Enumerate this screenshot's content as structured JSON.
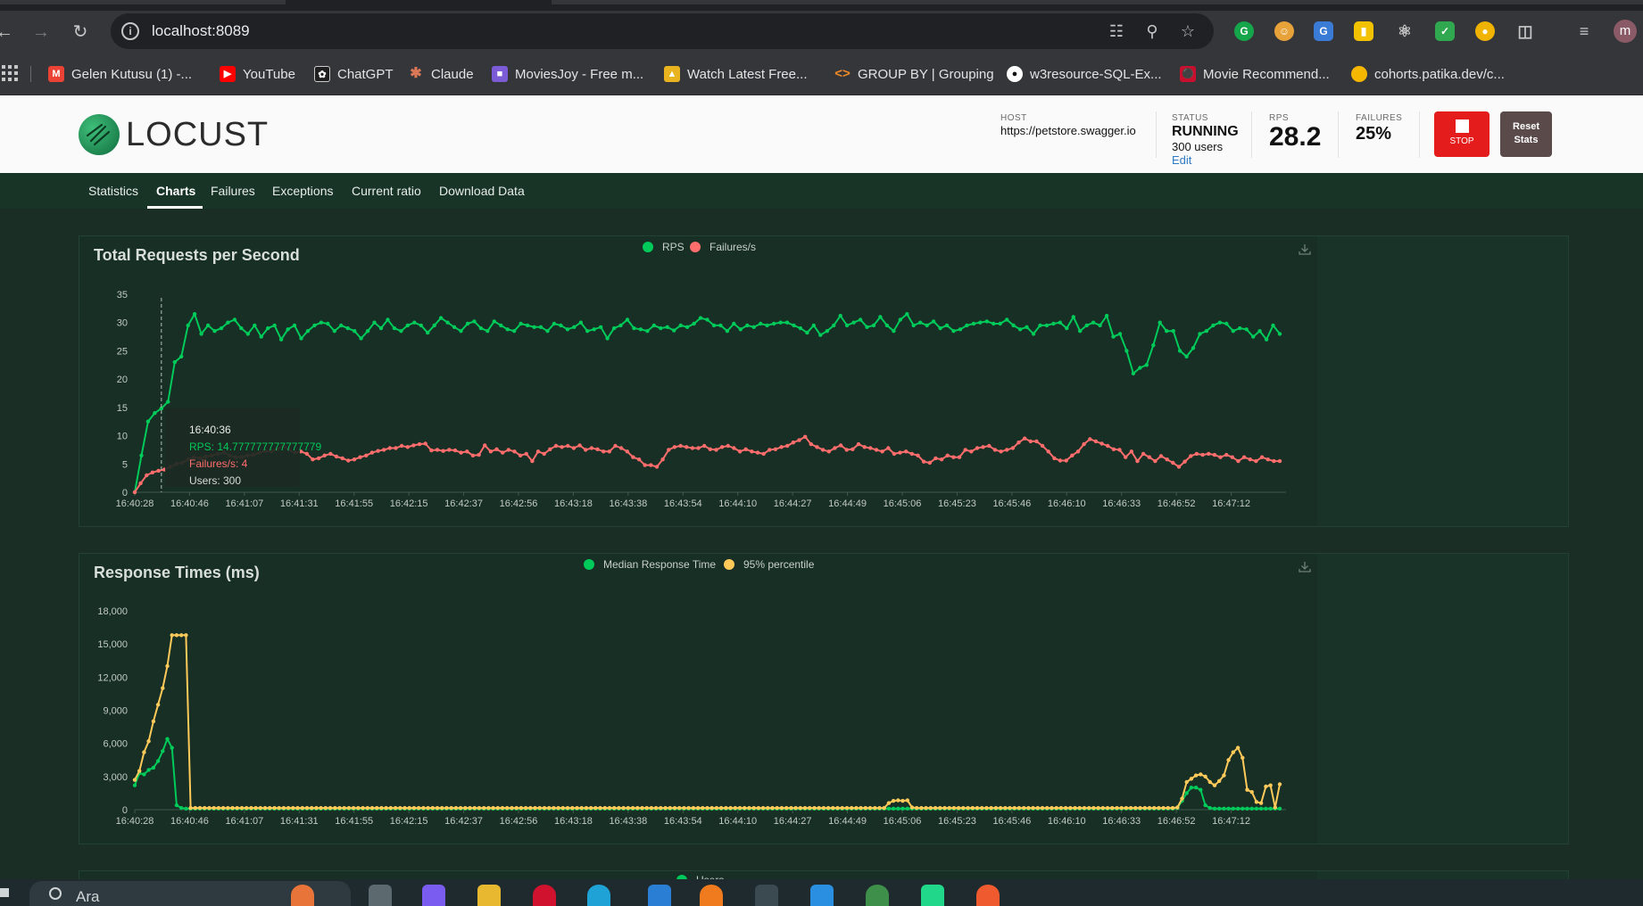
{
  "browser": {
    "url": "localhost:8089",
    "bookmarks": [
      {
        "label": "Gelen Kutusu (1) -...",
        "color": "#ea4335"
      },
      {
        "label": "YouTube",
        "color": "#ff0000"
      },
      {
        "label": "ChatGPT",
        "color": "#1f1f1f"
      },
      {
        "label": "Claude",
        "color": "#d97757"
      },
      {
        "label": "MoviesJoy - Free m...",
        "color": "#7b5cd6"
      },
      {
        "label": "Watch Latest Free...",
        "color": "#e8b31e"
      },
      {
        "label": "GROUP BY | Grouping",
        "color": "#f08a24"
      },
      {
        "label": "w3resource-SQL-Ex...",
        "color": "#ffffff"
      },
      {
        "label": "Movie Recommend...",
        "color": "#c8102e"
      },
      {
        "label": "cohorts.patika.dev/c...",
        "color": "#f6b700"
      }
    ],
    "profile_initial": "m"
  },
  "locust": {
    "logo_text": "LOCUST",
    "host_label": "HOST",
    "host": "https://petstore.swagger.io",
    "status_label": "STATUS",
    "status": "RUNNING",
    "users": "300 users",
    "edit": "Edit",
    "rps_label": "RPS",
    "rps": "28.2",
    "failures_label": "FAILURES",
    "failures": "25%",
    "stop_label": "STOP",
    "reset_label_1": "Reset",
    "reset_label_2": "Stats",
    "tabs": [
      "Statistics",
      "Charts",
      "Failures",
      "Exceptions",
      "Current ratio",
      "Download Data"
    ],
    "active_tab": "Charts"
  },
  "colors": {
    "green": "#00ca5a",
    "red": "#ff6d6d",
    "yellow": "#ffca5a"
  },
  "chart_data": [
    {
      "type": "line",
      "title": "Total Requests per Second",
      "x_ticks": [
        "16:40:28",
        "16:40:46",
        "16:41:07",
        "16:41:31",
        "16:41:55",
        "16:42:15",
        "16:42:37",
        "16:42:56",
        "16:43:18",
        "16:43:38",
        "16:43:54",
        "16:44:10",
        "16:44:27",
        "16:44:49",
        "16:45:06",
        "16:45:23",
        "16:45:46",
        "16:46:10",
        "16:46:33",
        "16:46:52",
        "16:47:12"
      ],
      "ylim": [
        0,
        35
      ],
      "y_ticks": [
        0,
        5,
        10,
        15,
        20,
        25,
        30,
        35
      ],
      "series": [
        {
          "name": "RPS",
          "color": "#00ca5a",
          "values": [
            0,
            6.5,
            12.5,
            14,
            14.8,
            16,
            23,
            24,
            29.5,
            31.5,
            28,
            29.5,
            28.5,
            29,
            30,
            30.5,
            29,
            28,
            29.5,
            27.5,
            29,
            29.5,
            27,
            28.8,
            29.5,
            27.2,
            28.5,
            29.5,
            30,
            29.8,
            28.5,
            29.5,
            29,
            28.5,
            27.2,
            28.5,
            30,
            29,
            30.5,
            29,
            28.5,
            29.5,
            30,
            29.5,
            28.2,
            29.5,
            30.8,
            30,
            29.2,
            28.5,
            29.8,
            30.2,
            29,
            28.5,
            30.2,
            29.5,
            28.8,
            28.5,
            29.8,
            29.5,
            29.2,
            29.2,
            28.5,
            29.8,
            29.5,
            28.8,
            29.2,
            30,
            28.5,
            28.8,
            29.2,
            27.2,
            29,
            29.5,
            30.5,
            29,
            28.8,
            28.5,
            29.5,
            29,
            29.2,
            28.6,
            29.5,
            29.2,
            29.8,
            30.8,
            30.5,
            29.5,
            29.5,
            28.5,
            29.8,
            28.8,
            29.5,
            29.2,
            29.8,
            29.5,
            29.8,
            30,
            30,
            29.5,
            29,
            28.2,
            29.5,
            27.8,
            28.5,
            29.5,
            31.2,
            29.5,
            30,
            30.5,
            29.2,
            29.5,
            31,
            29.5,
            28.5,
            30.5,
            31.5,
            29.5,
            30,
            29.5,
            30.2,
            29,
            29.5,
            28.5,
            28.8,
            29.5,
            29.8,
            30,
            30.2,
            29.8,
            29.8,
            30.5,
            29.5,
            28.8,
            29.2,
            28,
            29.5,
            29.5,
            29.8,
            30,
            29,
            31,
            28.5,
            29.5,
            30,
            29.5,
            31.2,
            27.5,
            28,
            25,
            21,
            22,
            22.5,
            26,
            30,
            28.5,
            28.5,
            25,
            24,
            25.5,
            28,
            28.5,
            29.5,
            30,
            29.8,
            28.5,
            29,
            28.8,
            27.5,
            28.5,
            27,
            29.5,
            28
          ]
        },
        {
          "name": "Failures/s",
          "color": "#ff6d6d",
          "values": [
            0,
            1.6,
            3,
            3.5,
            3.8,
            4,
            4.5,
            5,
            5.2,
            5.8,
            6.2,
            6,
            6.3,
            6.5,
            6.8,
            7,
            6.5,
            6.2,
            6.2,
            6.5,
            6.6,
            7,
            7.3,
            7.2,
            7.6,
            8.2,
            7.5,
            7,
            7.2,
            6.8,
            5.8,
            6,
            6.5,
            6.8,
            6.3,
            6,
            5.6,
            5.8,
            6.2,
            6.5,
            7,
            7.3,
            7.5,
            7.8,
            7.8,
            8.2,
            8,
            8.3,
            8.5,
            8.6,
            7.4,
            7.5,
            7.3,
            7.5,
            7.4,
            7,
            7.2,
            6.5,
            6.6,
            8.3,
            7.2,
            7.6,
            7,
            7.5,
            7.2,
            6.5,
            6.8,
            5.5,
            7.2,
            6.8,
            7.6,
            8.2,
            8,
            8.2,
            7.8,
            8.3,
            7.5,
            7.8,
            7.6,
            7.2,
            7.2,
            8.2,
            7.8,
            7.2,
            6.2,
            5.8,
            4.8,
            4.8,
            4.5,
            5.8,
            7.5,
            8,
            8.2,
            8,
            7.8,
            7.8,
            8.2,
            7.6,
            7.5,
            8,
            8.2,
            7.8,
            7.2,
            7.6,
            7.2,
            7,
            6.8,
            7.5,
            7.6,
            8,
            8.2,
            8.8,
            9.2,
            9.8,
            8.5,
            8,
            7.5,
            7.2,
            7.8,
            8.3,
            7.5,
            7.6,
            8.5,
            8,
            7.8,
            7.5,
            7.2,
            7.8,
            6.8,
            7,
            7.2,
            6.8,
            6.5,
            5.4,
            5.2,
            6,
            5.8,
            6.5,
            6.2,
            6.2,
            7.5,
            7.2,
            7.8,
            8,
            8.2,
            7.5,
            7.2,
            7.5,
            7.8,
            8.8,
            9.5,
            9,
            9,
            8.2,
            7.2,
            6,
            5.6,
            5.6,
            6.5,
            7.2,
            8.5,
            9.4,
            9,
            8.6,
            8.2,
            7.6,
            7.5,
            6.2,
            7.2,
            5.5,
            6.8,
            6.2,
            5.5,
            6.4,
            5.8,
            5.2,
            4.5,
            5.4,
            6.4,
            6.8,
            6.6,
            6.8,
            6.6,
            6.2,
            6.6,
            6.2,
            5.5,
            6.2,
            5.8,
            5.5,
            6.2,
            5.8,
            5.5,
            5.5
          ]
        }
      ],
      "tooltip": {
        "time": "16:40:36",
        "rps": "RPS: 14.777777777777779",
        "failures": "Failures/s: 4",
        "users": "Users: 300",
        "index": 4
      }
    },
    {
      "type": "line",
      "title": "Response Times (ms)",
      "x_ticks": [
        "16:40:28",
        "16:40:46",
        "16:41:07",
        "16:41:31",
        "16:41:55",
        "16:42:15",
        "16:42:37",
        "16:42:56",
        "16:43:18",
        "16:43:38",
        "16:43:54",
        "16:44:10",
        "16:44:27",
        "16:44:49",
        "16:45:06",
        "16:45:23",
        "16:45:46",
        "16:46:10",
        "16:46:33",
        "16:46:52",
        "16:47:12"
      ],
      "ylim": [
        0,
        18000
      ],
      "y_ticks": [
        0,
        3000,
        6000,
        9000,
        12000,
        15000,
        18000
      ],
      "series": [
        {
          "name": "Median Response Time",
          "color": "#00ca5a",
          "values": [
            2200,
            3300,
            3200,
            3600,
            3800,
            4400,
            5300,
            6400,
            5600,
            400,
            150,
            100,
            100,
            100,
            100,
            100,
            100,
            100,
            100,
            100,
            100,
            100,
            100,
            100,
            100,
            100,
            100,
            100,
            100,
            100,
            100,
            100,
            100,
            100,
            100,
            100,
            100,
            100,
            100,
            100,
            100,
            100,
            100,
            100,
            100,
            100,
            100,
            100,
            100,
            100,
            100,
            100,
            100,
            100,
            100,
            100,
            100,
            100,
            100,
            100,
            100,
            100,
            100,
            100,
            100,
            100,
            100,
            100,
            100,
            100,
            100,
            100,
            100,
            100,
            100,
            100,
            100,
            100,
            100,
            100,
            100,
            100,
            100,
            100,
            100,
            100,
            100,
            100,
            100,
            100,
            100,
            100,
            100,
            100,
            100,
            100,
            100,
            100,
            100,
            100,
            100,
            100,
            100,
            100,
            100,
            100,
            100,
            100,
            100,
            100,
            100,
            100,
            100,
            100,
            100,
            100,
            100,
            100,
            100,
            100,
            100,
            100,
            100,
            100,
            100,
            100,
            100,
            100,
            100,
            100,
            100,
            100,
            100,
            100,
            100,
            100,
            100,
            100,
            100,
            100,
            100,
            100,
            100,
            100,
            100,
            100,
            100,
            100,
            100,
            100,
            100,
            100,
            100,
            100,
            100,
            100,
            100,
            100,
            100,
            100,
            100,
            100,
            100,
            100,
            100,
            100,
            100,
            100,
            100,
            100,
            100,
            100,
            100,
            100,
            100,
            100,
            100,
            100,
            100,
            100,
            100,
            100,
            100,
            100,
            100,
            100,
            100,
            100,
            100,
            100,
            100,
            100,
            100,
            100,
            100,
            100,
            100,
            100,
            100,
            100,
            100,
            100,
            100,
            100,
            100,
            100,
            100,
            100,
            100,
            100,
            100,
            100,
            100,
            100,
            100,
            100,
            100,
            100,
            100,
            100,
            100,
            100,
            100,
            100,
            150,
            800,
            1500,
            2000,
            2000,
            1800,
            400,
            150,
            100,
            100,
            100,
            100,
            100,
            100,
            100,
            100,
            100,
            100,
            100,
            100,
            100,
            100,
            100
          ]
        },
        {
          "name": "95% percentile",
          "color": "#ffca5a",
          "values": [
            2700,
            3500,
            5200,
            6200,
            8000,
            9500,
            11000,
            13000,
            15800,
            15800,
            15800,
            15800,
            150,
            150,
            150,
            150,
            150,
            150,
            150,
            150,
            150,
            150,
            150,
            150,
            150,
            150,
            150,
            150,
            150,
            150,
            150,
            150,
            150,
            150,
            150,
            150,
            150,
            150,
            150,
            150,
            150,
            150,
            150,
            150,
            150,
            150,
            150,
            150,
            150,
            150,
            150,
            150,
            150,
            150,
            150,
            150,
            150,
            150,
            150,
            150,
            150,
            150,
            150,
            150,
            150,
            150,
            150,
            150,
            150,
            150,
            150,
            150,
            150,
            150,
            150,
            150,
            150,
            150,
            150,
            150,
            150,
            150,
            150,
            150,
            150,
            150,
            150,
            150,
            150,
            150,
            150,
            150,
            150,
            150,
            150,
            150,
            150,
            150,
            150,
            150,
            150,
            150,
            150,
            150,
            150,
            150,
            150,
            150,
            150,
            150,
            150,
            150,
            150,
            150,
            150,
            150,
            150,
            150,
            150,
            150,
            150,
            150,
            150,
            150,
            150,
            150,
            150,
            150,
            150,
            150,
            150,
            150,
            150,
            150,
            150,
            150,
            150,
            150,
            150,
            150,
            150,
            150,
            150,
            150,
            150,
            150,
            150,
            150,
            150,
            150,
            150,
            150,
            150,
            150,
            150,
            150,
            150,
            150,
            150,
            150,
            150,
            150,
            600,
            800,
            850,
            800,
            850,
            200,
            150,
            150,
            150,
            150,
            150,
            150,
            150,
            150,
            150,
            150,
            150,
            150,
            150,
            150,
            150,
            150,
            150,
            150,
            150,
            150,
            150,
            150,
            150,
            150,
            150,
            150,
            150,
            150,
            150,
            150,
            150,
            150,
            150,
            150,
            150,
            150,
            150,
            150,
            150,
            150,
            150,
            150,
            150,
            150,
            150,
            150,
            150,
            150,
            150,
            150,
            150,
            150,
            150,
            150,
            150,
            150,
            200,
            1000,
            2500,
            2800,
            3100,
            3200,
            3000,
            2500,
            2200,
            2600,
            3100,
            4500,
            5200,
            5600,
            4700,
            1800,
            1600,
            700,
            600,
            2100,
            2200,
            200,
            2300
          ]
        }
      ]
    }
  ],
  "partial_chart_legend": "Users"
}
